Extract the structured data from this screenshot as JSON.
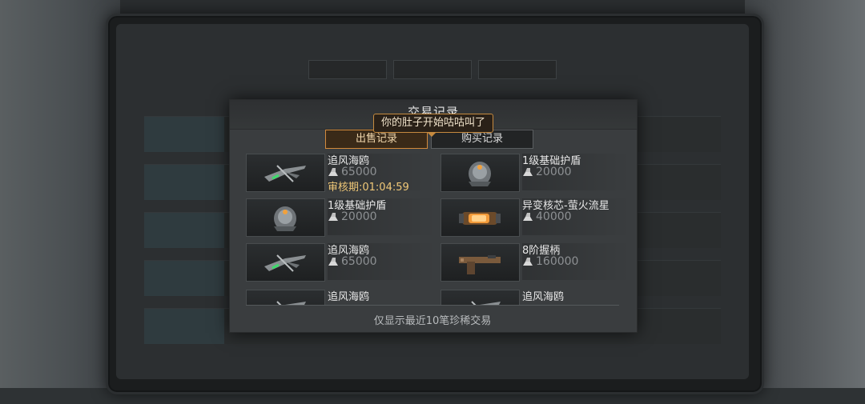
{
  "modal": {
    "title": "交易记录",
    "tooltip": "你的肚子开始咕咕叫了",
    "tabs": [
      {
        "label": "出售记录",
        "active": true
      },
      {
        "label": "购买记录",
        "active": false
      }
    ],
    "footer": "仅显示最近10笔珍稀交易"
  },
  "items": [
    {
      "name": "追风海鸥",
      "price": "65000",
      "review": "审核期:01:04:59",
      "icon": "crossbow-icon"
    },
    {
      "name": "1级基础护盾",
      "price": "20000",
      "review": "",
      "icon": "shield-orb-icon"
    },
    {
      "name": "1级基础护盾",
      "price": "20000",
      "review": "",
      "icon": "shield-orb-icon"
    },
    {
      "name": "异变核芯-萤火流星",
      "price": "40000",
      "review": "",
      "icon": "core-canister-icon"
    },
    {
      "name": "追风海鸥",
      "price": "65000",
      "review": "",
      "icon": "crossbow-icon"
    },
    {
      "name": "8阶握柄",
      "price": "160000",
      "review": "",
      "icon": "weapon-grip-icon"
    },
    {
      "name": "追风海鸥",
      "price": "",
      "review": "",
      "icon": "crossbow-icon"
    },
    {
      "name": "追风海鸥",
      "price": "",
      "review": "",
      "icon": "crossbow-icon"
    }
  ],
  "colors": {
    "accent": "#d28a3c",
    "review_text": "#f0c878",
    "price_text": "#8d9093"
  }
}
